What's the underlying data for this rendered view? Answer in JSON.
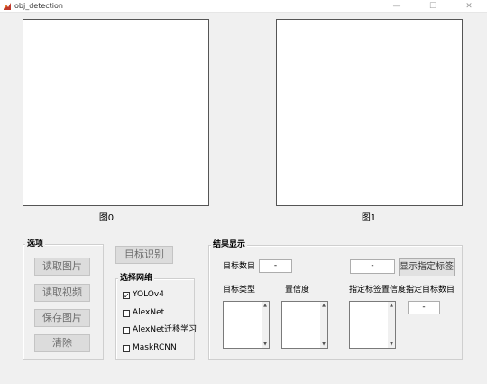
{
  "window": {
    "title": "obj_detection",
    "minimize_glyph": "—",
    "maximize_glyph": "☐",
    "close_glyph": "✕"
  },
  "canvases": {
    "left_label": "图0",
    "right_label": "图1"
  },
  "options_panel": {
    "title": "选项",
    "read_image": "读取图片",
    "read_video": "读取视频",
    "save_image": "保存图片",
    "clear": "清除"
  },
  "detect_button": "目标识别",
  "network_panel": {
    "title": "选择网络",
    "items": [
      {
        "label": "YOLOv4",
        "checked": true
      },
      {
        "label": "AlexNet",
        "checked": false
      },
      {
        "label": "AlexNet迁移学习",
        "checked": false
      },
      {
        "label": "MaskRCNN",
        "checked": false
      }
    ]
  },
  "results_panel": {
    "title": "结果显示",
    "target_count_label": "目标数目",
    "target_count_value": "-",
    "label_input_value": "-",
    "show_label_button": "显示指定标签",
    "target_type_label": "目标类型",
    "confidence_label": "置信度",
    "label_confidence_label": "指定标签置信度",
    "specified_count_label": "指定目标数目",
    "specified_count_value": "-"
  },
  "icons": {
    "app": "matlab-figure-icon",
    "checkmark": "☑",
    "unchecked": "☐",
    "scroll_up": "▲",
    "scroll_down": "▼"
  }
}
